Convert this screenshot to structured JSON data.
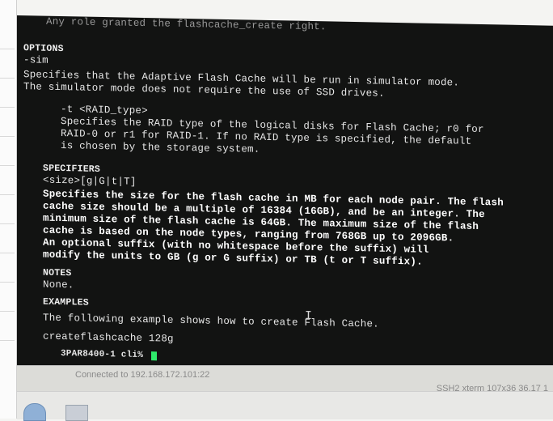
{
  "terminal": {
    "lines": [
      {
        "text": "  Any role granted the flashcache_create right.",
        "cls": "dim"
      },
      {
        "text": "OPTIONS",
        "cls": "hdr"
      },
      {
        "text": "  -sim",
        "cls": ""
      },
      {
        "text": "      Specifies that the Adaptive Flash Cache will be run in simulator mode.",
        "cls": ""
      },
      {
        "text": "      The simulator mode does not require the use of SSD drives.",
        "cls": ""
      },
      {
        "text": "  -t <RAID_type>",
        "cls": ""
      },
      {
        "text": "      Specifies the RAID type of the logical disks for Flash Cache; r0 for",
        "cls": ""
      },
      {
        "text": "      RAID-0 or r1 for RAID-1. If no RAID type is specified, the default",
        "cls": ""
      },
      {
        "text": "      is chosen by the storage system.",
        "cls": ""
      },
      {
        "text": "SPECIFIERS",
        "cls": "hdr"
      },
      {
        "text": "  <size>[g|G|t|T]",
        "cls": ""
      },
      {
        "text": "  Specifies the size for the flash cache in MB for each node pair. The flash",
        "cls": "bold"
      },
      {
        "text": "  cache size should be a multiple of 16384 (16GB), and be an integer. The",
        "cls": "bold"
      },
      {
        "text": "  minimum size of the flash cache is 64GB. The maximum size of the flash",
        "cls": "bold"
      },
      {
        "text": "  cache is based on the node types, ranging from 768GB up to 2096GB.",
        "cls": "bold"
      },
      {
        "text": "  An optional suffix (with no whitespace before the suffix) will",
        "cls": "bold"
      },
      {
        "text": "  modify the units to GB (g or G suffix) or TB (t or T suffix).",
        "cls": "bold"
      },
      {
        "text": "NOTES",
        "cls": "hdr"
      },
      {
        "text": "  None.",
        "cls": ""
      },
      {
        "text": "EXAMPLES",
        "cls": "hdr"
      },
      {
        "text": "  The following example shows how to create Flash Cache.",
        "cls": ""
      },
      {
        "text": "  createflashcache 128g",
        "cls": ""
      },
      {
        "text": "3PAR8400-1 cli% ",
        "cls": ""
      }
    ]
  },
  "status_bar": {
    "connection": "Connected to 192.168.172.101:22",
    "session": "SSH2  xterm  107x36  36,17  1"
  },
  "colors": {
    "terminal_bg": "#121312",
    "terminal_fg": "#e6e6e6",
    "cursor": "#2ee86a"
  }
}
